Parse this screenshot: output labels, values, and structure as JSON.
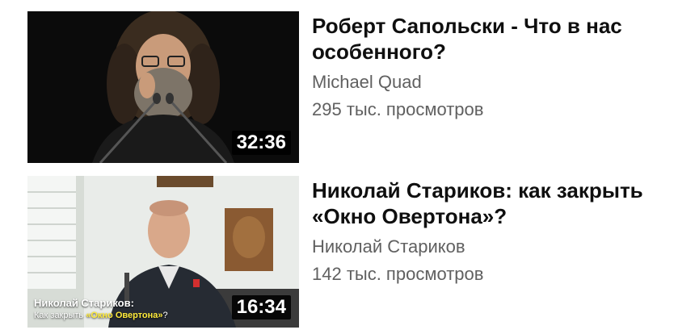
{
  "videos": [
    {
      "title": "Роберт Сапольски - Что в нас особенного?",
      "channel": "Michael Quad",
      "views": "295 тыс. просмотров",
      "duration": "32:36"
    },
    {
      "title": "Николай Стариков: как закрыть «Окно Овертона»?",
      "channel": "Николай Стариков",
      "views": "142 тыс. просмотров",
      "duration": "16:34",
      "thumb_caption": {
        "name": "Николай Стариков:",
        "sub_before": "Как закрыть ",
        "sub_bold": "«Окно Овертона»",
        "sub_after": "?"
      }
    }
  ],
  "colors": {
    "title": "#0f0f0f",
    "meta": "#606060",
    "caption_accent": "#ffeb3b"
  }
}
